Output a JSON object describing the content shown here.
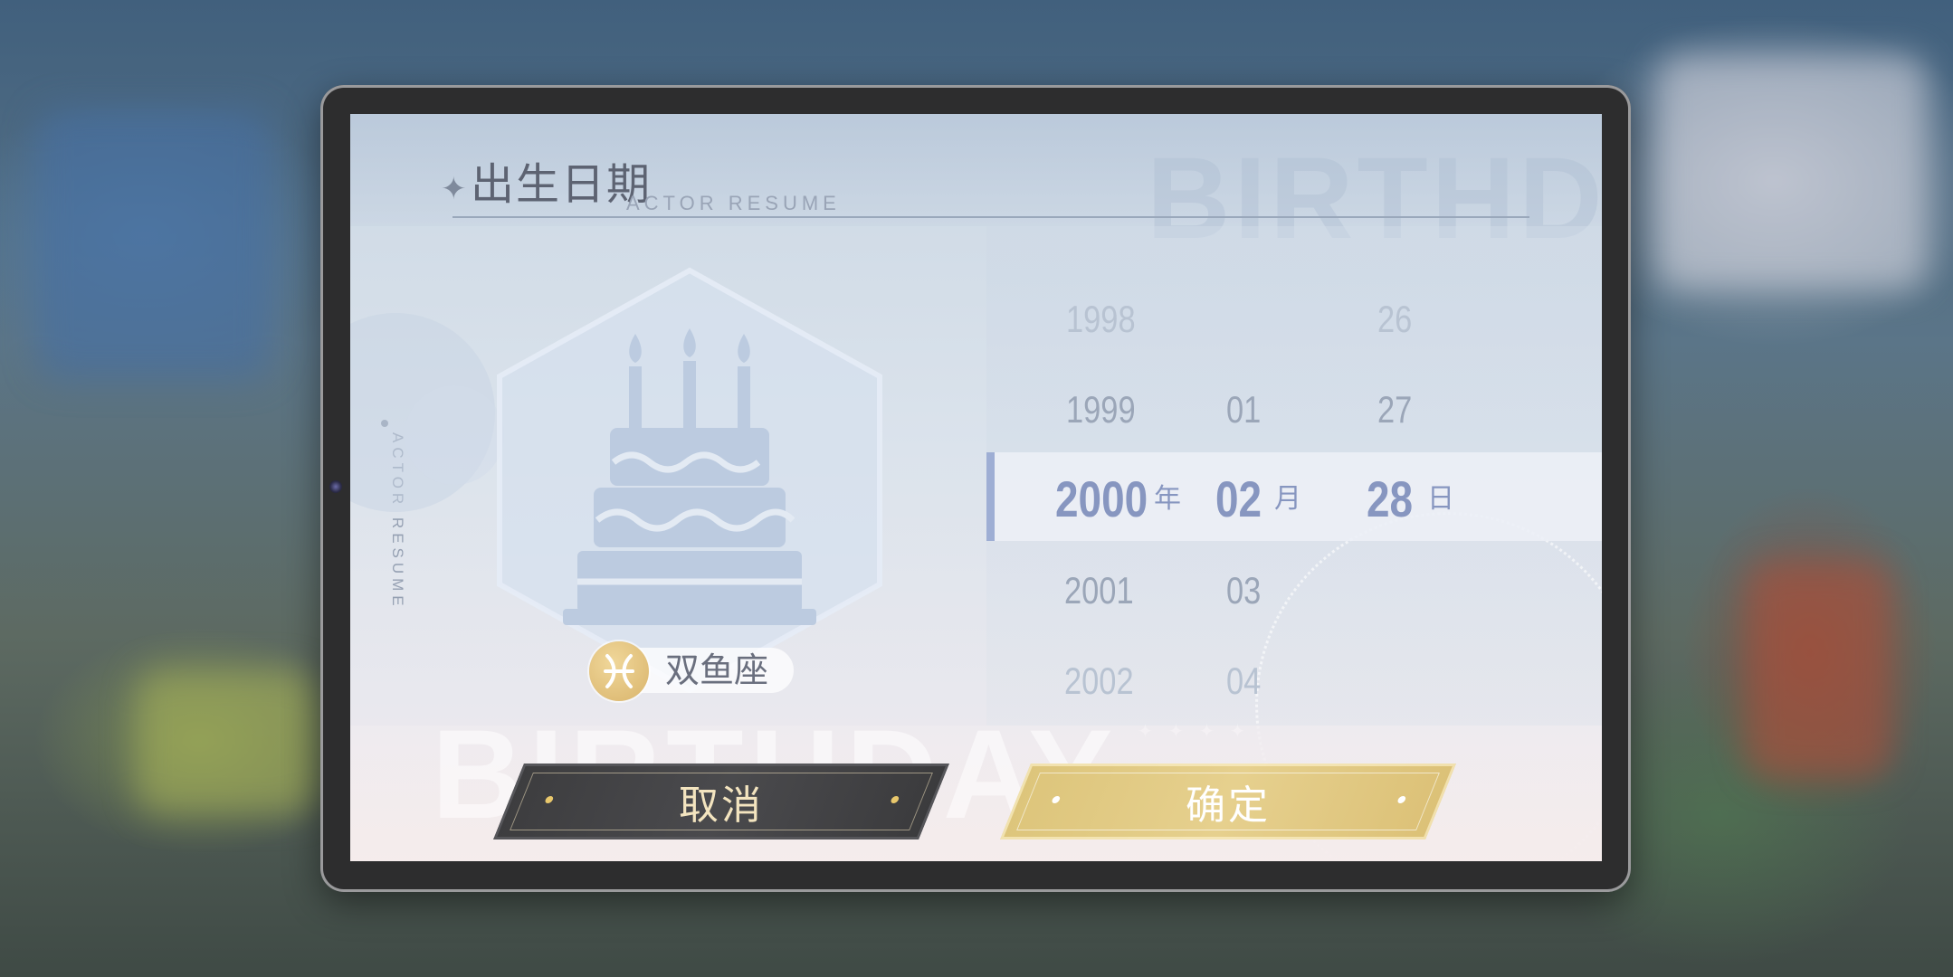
{
  "dialog": {
    "title": "出生日期",
    "subtitle": "ACTOR RESUME",
    "side_label": "ACTOR RESUME",
    "watermark_header": "BIRTHDAY",
    "watermark_bottom": "BIRTHDAY"
  },
  "zodiac": {
    "label": "双鱼座",
    "icon": "pisces-icon",
    "symbol": "♓"
  },
  "picker": {
    "years": [
      "1998",
      "1999",
      "2000",
      "2001",
      "2002"
    ],
    "months": [
      "01",
      "02",
      "03",
      "04"
    ],
    "days": [
      "26",
      "27",
      "28"
    ],
    "selected": {
      "year": "2000",
      "month": "02",
      "day": "28"
    },
    "units": {
      "year": "年",
      "month": "月",
      "day": "日"
    }
  },
  "buttons": {
    "cancel_label": "取消",
    "confirm_label": "确定"
  },
  "colors": {
    "accent_selected": "#8796c0",
    "confirm_gold": "#e3cb86",
    "cancel_dark": "#434345"
  }
}
